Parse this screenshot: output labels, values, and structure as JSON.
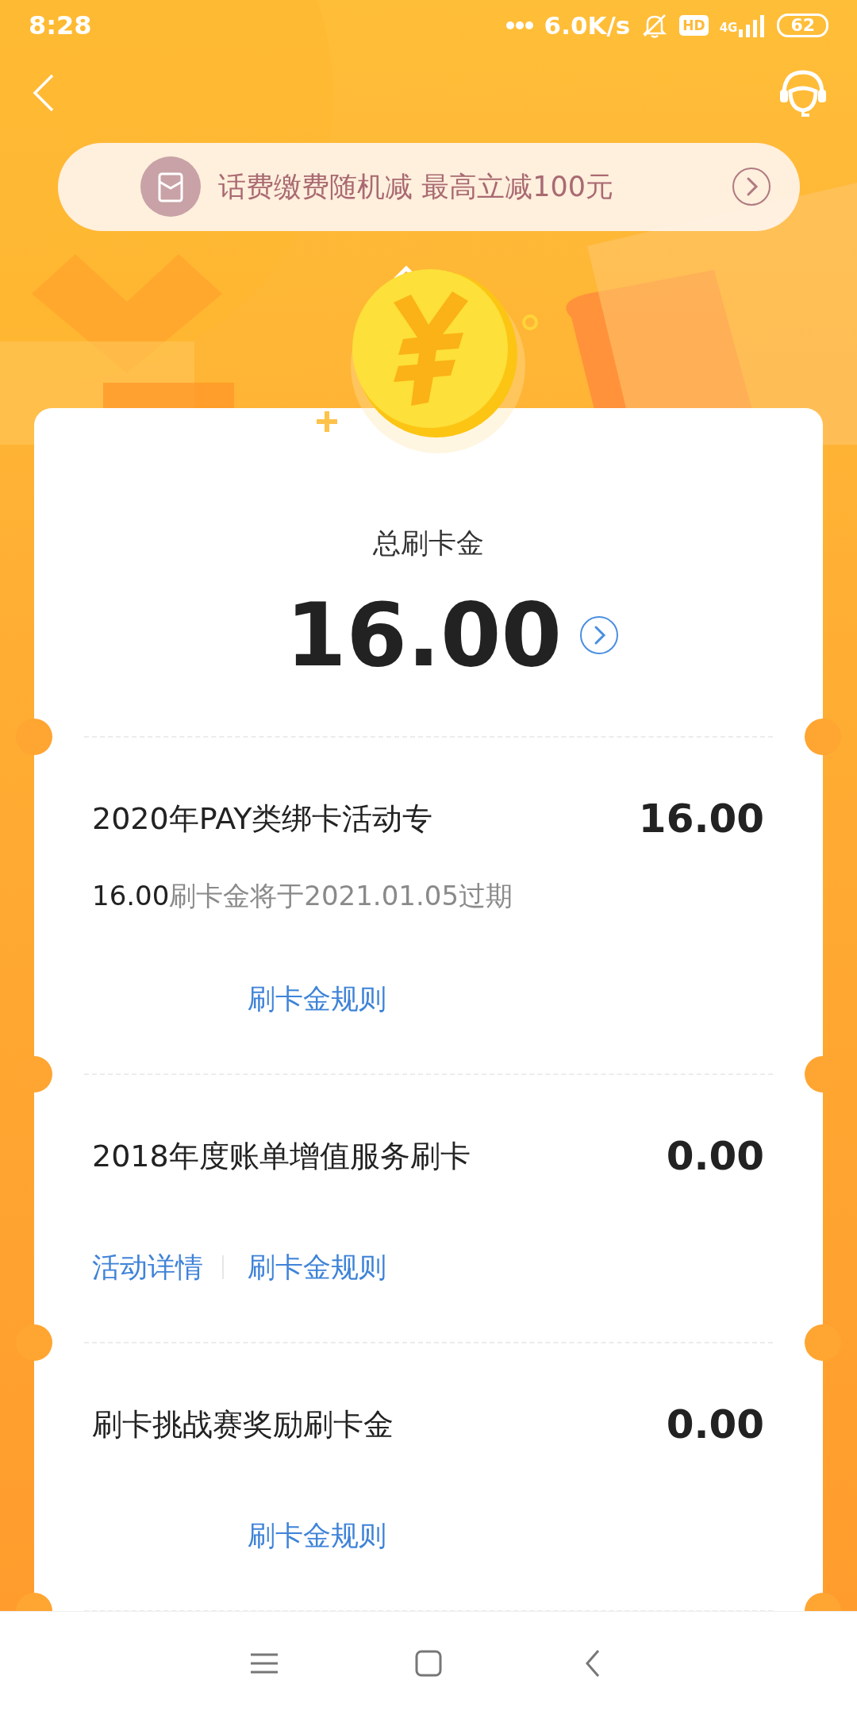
{
  "status_bar": {
    "time": "8:28",
    "speed": "6.0K/s",
    "hd": "HD",
    "network": "4G",
    "battery": "62"
  },
  "banner": {
    "text": "话费缴费随机减 最高立减100元"
  },
  "summary": {
    "label": "总刷卡金",
    "amount": "16.00"
  },
  "rows": [
    {
      "title": "2020年PAY类绑卡活动专",
      "amount": "16.00",
      "expiry_amount": "16.00",
      "expiry_text": "刷卡金将于2021.01.05过期",
      "rules_link": "刷卡金规则"
    },
    {
      "title": "2018年度账单增值服务刷卡",
      "amount": "0.00",
      "detail_link": "活动详情",
      "rules_link": "刷卡金规则"
    },
    {
      "title": "刷卡挑战赛奖励刷卡金",
      "amount": "0.00",
      "rules_link": "刷卡金规则"
    }
  ]
}
